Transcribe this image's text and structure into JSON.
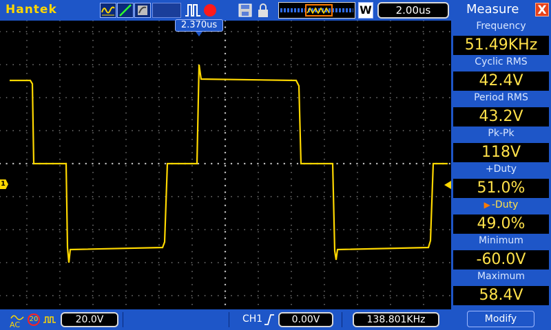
{
  "topbar": {
    "brand": "Hantek",
    "timebase": "2.00us",
    "zoom_label": "W",
    "icons": [
      "waveform-icon",
      "ramp-icon",
      "dots-icon",
      "pulse-icon",
      "record-icon",
      "save-icon",
      "lock-icon",
      "timeline-icon"
    ]
  },
  "trigger_position": "2.370us",
  "channel": {
    "marker": "1",
    "color": "#ffd800"
  },
  "bottombar": {
    "coupling": "AC",
    "bw_limit": "20",
    "volts_div": "20.0V",
    "trigger_source": "CH1",
    "trigger_level": "0.00V",
    "trigger_freq": "138.801KHz"
  },
  "measure": {
    "title": "Measure",
    "close": "X",
    "modify": "Modify",
    "items": [
      {
        "label": "Frequency",
        "value": "51.49KHz"
      },
      {
        "label": "Cyclic RMS",
        "value": "42.4V"
      },
      {
        "label": "Period RMS",
        "value": "43.2V"
      },
      {
        "label": "Pk-Pk",
        "value": "118V"
      },
      {
        "label": "+Duty",
        "value": "51.0%"
      },
      {
        "label": "-Duty",
        "value": "49.0%",
        "selected": true
      },
      {
        "label": "Minimum",
        "value": "-60.0V"
      },
      {
        "label": "Maximum",
        "value": "58.4V"
      }
    ]
  },
  "colors": {
    "accent": "#1e56c8",
    "trace": "#ffd800",
    "value_text": "#ffe14a",
    "close_button": "#e8421a",
    "record": "#ff1a1a"
  }
}
